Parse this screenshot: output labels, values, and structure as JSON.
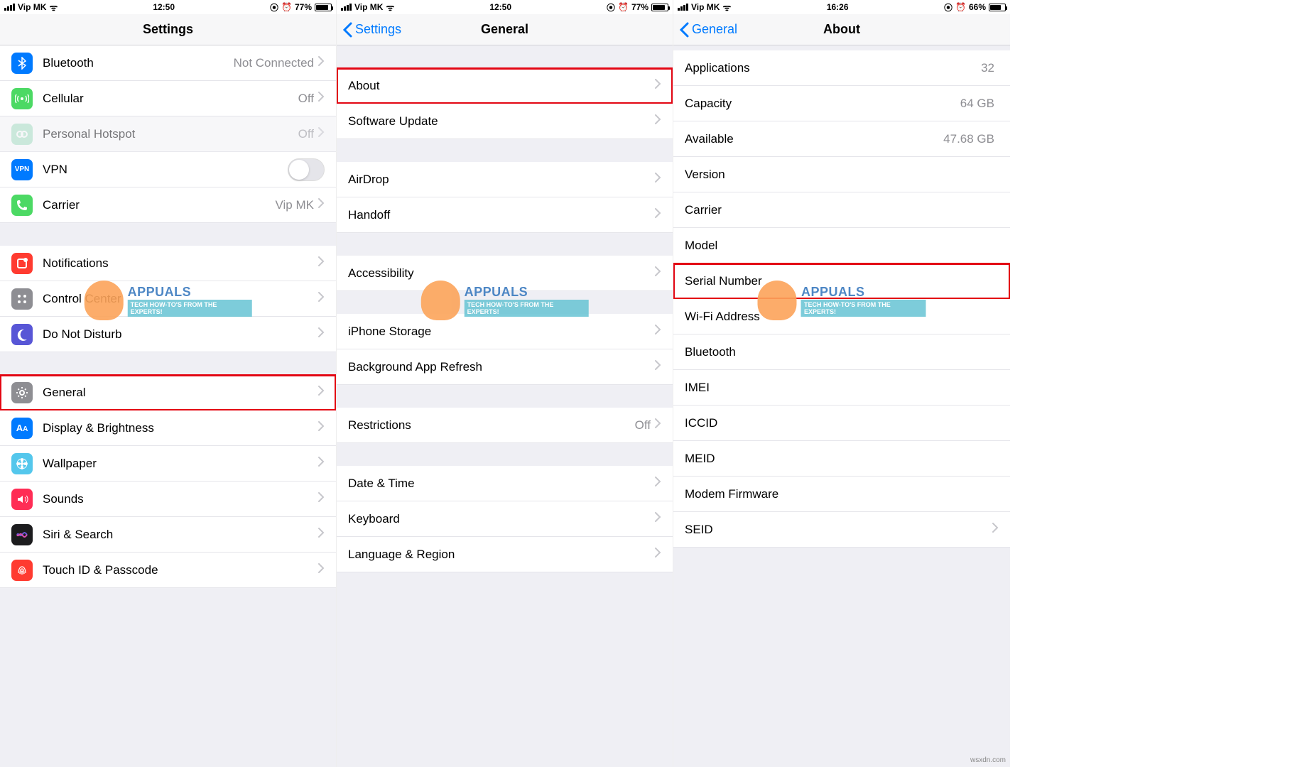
{
  "phones": [
    {
      "status": {
        "carrier": "Vip MK",
        "time": "12:50",
        "battery_pct": "77%",
        "battery_fill": 77
      },
      "nav": {
        "back": null,
        "title": "Settings"
      },
      "rows": [
        {
          "icon": "bluetooth",
          "icon_cls": "ic-blue",
          "label": "Bluetooth",
          "value": "Not Connected",
          "chev": true,
          "name": "row-bluetooth"
        },
        {
          "icon": "cellular",
          "icon_cls": "ic-green",
          "label": "Cellular",
          "value": "Off",
          "chev": true,
          "name": "row-cellular"
        },
        {
          "icon": "hotspot",
          "icon_cls": "ic-mint",
          "label": "Personal Hotspot",
          "value": "Off",
          "chev": true,
          "name": "row-hotspot",
          "dim": true
        },
        {
          "icon": "vpn",
          "icon_cls": "ic-vpn",
          "label": "VPN",
          "toggle": true,
          "name": "row-vpn"
        },
        {
          "icon": "phone",
          "icon_cls": "ic-phone",
          "label": "Carrier",
          "value": "Vip MK",
          "chev": true,
          "name": "row-carrier"
        },
        {
          "gap": true
        },
        {
          "icon": "notifications",
          "icon_cls": "ic-red",
          "label": "Notifications",
          "chev": true,
          "name": "row-notifications"
        },
        {
          "icon": "control-center",
          "icon_cls": "ic-grey",
          "label": "Control Center",
          "chev": true,
          "name": "row-control-center"
        },
        {
          "icon": "moon",
          "icon_cls": "ic-moon",
          "label": "Do Not Disturb",
          "chev": true,
          "name": "row-dnd"
        },
        {
          "gap": true
        },
        {
          "icon": "gear",
          "icon_cls": "ic-dgrey",
          "label": "General",
          "chev": true,
          "name": "row-general",
          "hl": true
        },
        {
          "icon": "display",
          "icon_cls": "ic-disp",
          "label": "Display & Brightness",
          "chev": true,
          "name": "row-display"
        },
        {
          "icon": "wallpaper",
          "icon_cls": "ic-wall",
          "label": "Wallpaper",
          "chev": true,
          "name": "row-wallpaper"
        },
        {
          "icon": "sounds",
          "icon_cls": "ic-sound",
          "label": "Sounds",
          "chev": true,
          "name": "row-sounds"
        },
        {
          "icon": "siri",
          "icon_cls": "ic-siri",
          "label": "Siri & Search",
          "chev": true,
          "name": "row-siri"
        },
        {
          "icon": "touchid",
          "icon_cls": "ic-touch",
          "label": "Touch ID & Passcode",
          "chev": true,
          "name": "row-touchid"
        }
      ]
    },
    {
      "status": {
        "carrier": "Vip MK",
        "time": "12:50",
        "battery_pct": "77%",
        "battery_fill": 77
      },
      "nav": {
        "back": "Settings",
        "title": "General"
      },
      "rows": [
        {
          "gap": true
        },
        {
          "label": "About",
          "chev": true,
          "name": "row-about",
          "hl": true
        },
        {
          "label": "Software Update",
          "chev": true,
          "name": "row-software-update"
        },
        {
          "gap": true
        },
        {
          "label": "AirDrop",
          "chev": true,
          "name": "row-airdrop"
        },
        {
          "label": "Handoff",
          "chev": true,
          "name": "row-handoff"
        },
        {
          "gap": true
        },
        {
          "label": "Accessibility",
          "chev": true,
          "name": "row-accessibility"
        },
        {
          "gap": true
        },
        {
          "label": "iPhone Storage",
          "chev": true,
          "name": "row-storage"
        },
        {
          "label": "Background App Refresh",
          "chev": true,
          "name": "row-background-refresh"
        },
        {
          "gap": true
        },
        {
          "label": "Restrictions",
          "value": "Off",
          "chev": true,
          "name": "row-restrictions"
        },
        {
          "gap": true
        },
        {
          "label": "Date & Time",
          "chev": true,
          "name": "row-date-time"
        },
        {
          "label": "Keyboard",
          "chev": true,
          "name": "row-keyboard"
        },
        {
          "label": "Language & Region",
          "chev": true,
          "name": "row-language"
        }
      ]
    },
    {
      "status": {
        "carrier": "Vip MK",
        "time": "16:26",
        "battery_pct": "66%",
        "battery_fill": 66
      },
      "nav": {
        "back": "General",
        "title": "About"
      },
      "rows": [
        {
          "gap_sm": true
        },
        {
          "label": "Applications",
          "value": "32",
          "name": "row-applications"
        },
        {
          "label": "Capacity",
          "value": "64 GB",
          "name": "row-capacity"
        },
        {
          "label": "Available",
          "value": "47.68 GB",
          "name": "row-available"
        },
        {
          "label": "Version",
          "name": "row-version"
        },
        {
          "label": "Carrier",
          "name": "row-about-carrier"
        },
        {
          "label": "Model",
          "name": "row-model"
        },
        {
          "label": "Serial Number",
          "name": "row-serial",
          "hl": true
        },
        {
          "label": "Wi-Fi Address",
          "name": "row-wifi-addr"
        },
        {
          "label": "Bluetooth",
          "name": "row-bt-addr"
        },
        {
          "label": "IMEI",
          "name": "row-imei"
        },
        {
          "label": "ICCID",
          "name": "row-iccid"
        },
        {
          "label": "MEID",
          "name": "row-meid"
        },
        {
          "label": "Modem Firmware",
          "name": "row-modem"
        },
        {
          "label": "SEID",
          "chev": true,
          "name": "row-seid"
        }
      ]
    }
  ],
  "watermark": {
    "brand": "APPUALS",
    "tag": "TECH HOW-TO'S FROM THE EXPERTS!"
  },
  "credit": "wsxdn.com",
  "icons": {
    "bluetooth": "B",
    "cellular": "((•))",
    "hotspot": "⎋",
    "vpn": "VPN",
    "phone": "✆",
    "notifications": "◻",
    "control-center": "⊞",
    "moon": "☾",
    "gear": "⚙",
    "display": "AA",
    "wallpaper": "❋",
    "sounds": "🔊",
    "siri": "◉",
    "touchid": "◉"
  }
}
